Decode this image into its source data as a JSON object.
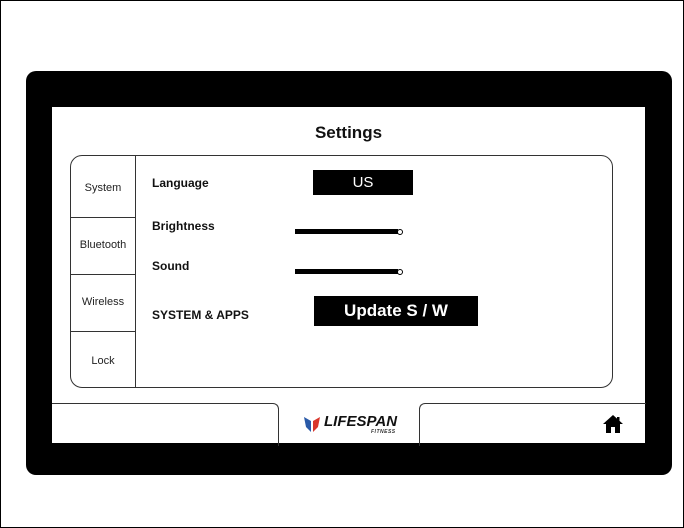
{
  "screen": {
    "title": "Settings"
  },
  "tabs": [
    {
      "label": "System"
    },
    {
      "label": "Bluetooth"
    },
    {
      "label": "Wireless"
    },
    {
      "label": "Lock"
    }
  ],
  "settings": {
    "language": {
      "label": "Language",
      "value": "US"
    },
    "brightness": {
      "label": "Brightness",
      "level": 0.92
    },
    "sound": {
      "label": "Sound",
      "level": 0.92
    },
    "system_apps": {
      "label": "SYSTEM & APPS",
      "button_label": "Update S / W"
    }
  },
  "footer": {
    "logo": {
      "name": "LIFESPAN",
      "sub": "FITNESS"
    },
    "home_icon": "home-icon"
  },
  "colors": {
    "bezel": "#000000",
    "logo_blue": "#2a5aa8",
    "logo_red": "#d9362b"
  }
}
